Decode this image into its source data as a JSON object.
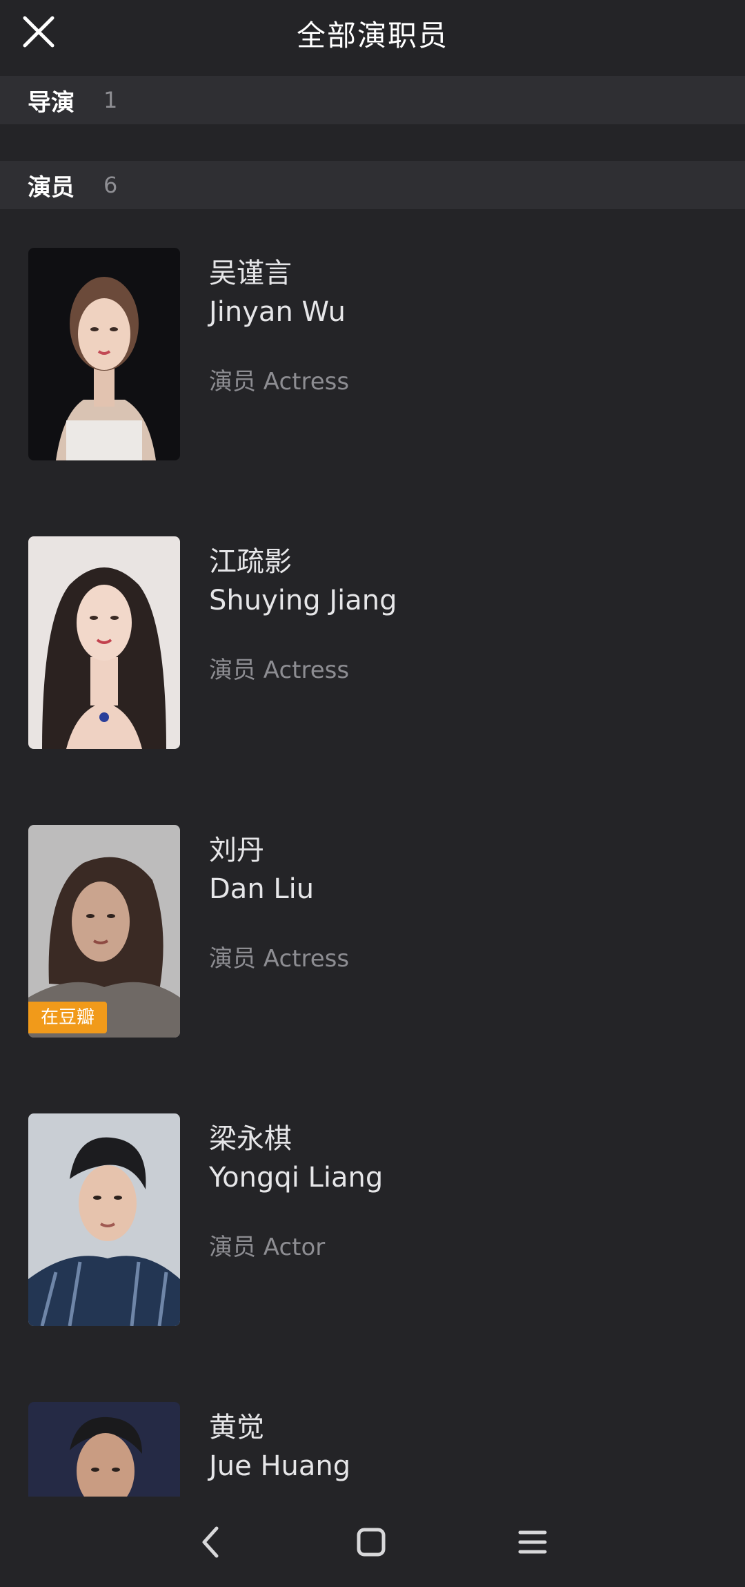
{
  "header": {
    "title": "全部演职员"
  },
  "sections": {
    "director": {
      "label": "导演",
      "count": "1"
    },
    "cast": {
      "label": "演员",
      "count": "6"
    }
  },
  "cast": [
    {
      "name_cn": "吴谨言",
      "name_en": "Jinyan Wu",
      "role": "演员 Actress",
      "badge": ""
    },
    {
      "name_cn": "江疏影",
      "name_en": "Shuying Jiang",
      "role": "演员 Actress",
      "badge": ""
    },
    {
      "name_cn": "刘丹",
      "name_en": "Dan Liu",
      "role": "演员 Actress",
      "badge": "在豆瓣"
    },
    {
      "name_cn": "梁永棋",
      "name_en": "Yongqi Liang",
      "role": "演员 Actor",
      "badge": ""
    },
    {
      "name_cn": "黄觉",
      "name_en": "Jue Huang",
      "role": "",
      "badge": ""
    }
  ],
  "navbar": {
    "back_icon": "chevron-left-icon",
    "home_icon": "rounded-square-icon",
    "menu_icon": "hamburger-icon"
  },
  "colors": {
    "background": "#242427",
    "section_background": "#2f2f33",
    "badge": "#f19a1a",
    "primary_text": "#e6e6e8",
    "secondary_text": "#8d8d92"
  }
}
